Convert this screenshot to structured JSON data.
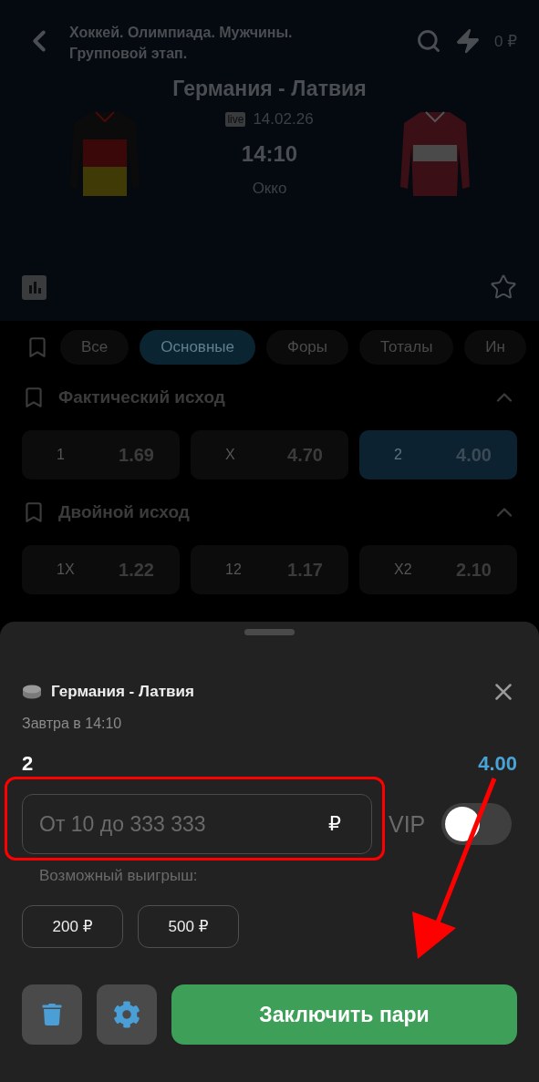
{
  "header": {
    "title": "Хоккей. Олимпиада. Мужчины. Групповой этап.",
    "balance": "0 ₽"
  },
  "match": {
    "teams": "Германия - Латвия",
    "live_badge": "live",
    "date": "14.02.26",
    "time": "14:10",
    "broadcaster": "Окко",
    "favorite": false
  },
  "market_tabs": [
    {
      "label": "Все",
      "selected": false
    },
    {
      "label": "Основные",
      "selected": true
    },
    {
      "label": "Форы",
      "selected": false
    },
    {
      "label": "Тоталы",
      "selected": false
    },
    {
      "label": "Ин",
      "selected": false
    }
  ],
  "markets": [
    {
      "title": "Фактический исход",
      "expanded": true,
      "outcomes": [
        {
          "label": "1",
          "odds": "1.69",
          "selected": false
        },
        {
          "label": "X",
          "odds": "4.70",
          "selected": false
        },
        {
          "label": "2",
          "odds": "4.00",
          "selected": true
        }
      ]
    },
    {
      "title": "Двойной исход",
      "expanded": true,
      "outcomes": [
        {
          "label": "1X",
          "odds": "1.22",
          "selected": false
        },
        {
          "label": "12",
          "odds": "1.17",
          "selected": false
        },
        {
          "label": "X2",
          "odds": "2.10",
          "selected": false
        }
      ]
    }
  ],
  "bet_slip": {
    "event": "Германия - Латвия",
    "time": "Завтра в 14:10",
    "outcome": "2",
    "odds": "4.00",
    "stake_placeholder": "От 10 до 333 333",
    "currency": "₽",
    "vip_label": "VIP",
    "vip_on": false,
    "possible_win_label": "Возможный выигрыш:",
    "quick_stakes": [
      "200 ₽",
      "500 ₽"
    ],
    "submit": "Заключить пари"
  }
}
